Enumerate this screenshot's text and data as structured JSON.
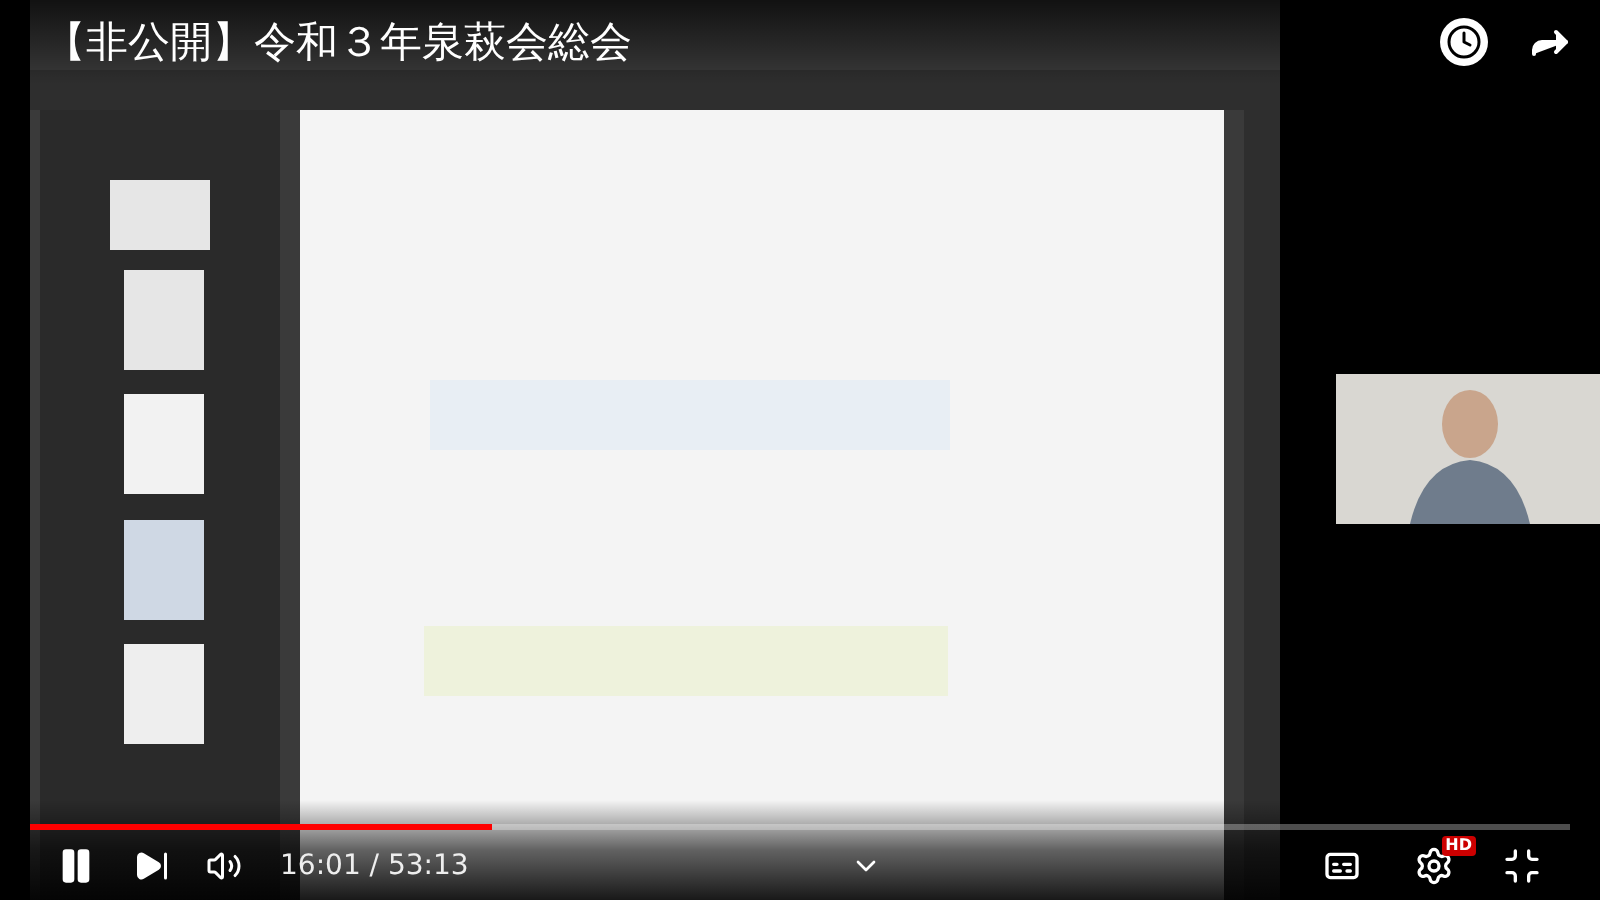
{
  "video": {
    "title": "【非公開】令和３年泉萩会総会"
  },
  "player": {
    "progress": {
      "level": 0.3
    },
    "playing": true,
    "time": "16:01 / 53:13",
    "quality_badge": "HD"
  }
}
